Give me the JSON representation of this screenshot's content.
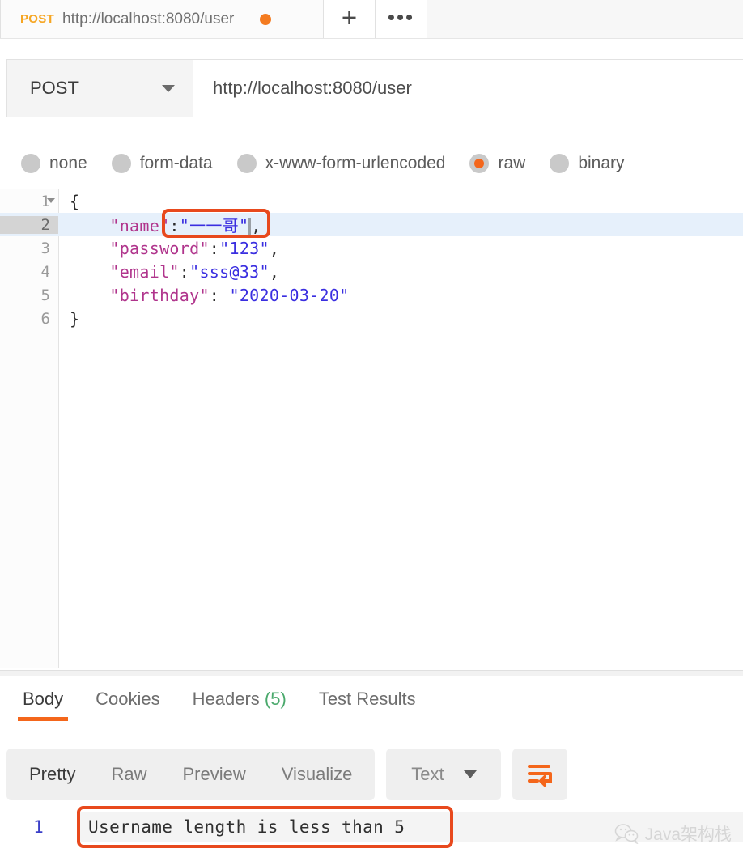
{
  "tab": {
    "method": "POST",
    "url": "http://localhost:8080/user",
    "unsaved_dot": "unsaved-indicator",
    "new_tab_label": "+",
    "more_label": "•••"
  },
  "request": {
    "method": "POST",
    "url": "http://localhost:8080/user",
    "body_types": [
      {
        "label": "none",
        "selected": false
      },
      {
        "label": "form-data",
        "selected": false
      },
      {
        "label": "x-www-form-urlencoded",
        "selected": false
      },
      {
        "label": "raw",
        "selected": true
      },
      {
        "label": "binary",
        "selected": false
      }
    ]
  },
  "editor": {
    "active_line": 2,
    "lines": [
      {
        "number": "1",
        "foldable": true,
        "text": "{"
      },
      {
        "number": "2",
        "foldable": false,
        "text": "    \"name\":\"一一哥\","
      },
      {
        "number": "3",
        "foldable": false,
        "text": "    \"password\":\"123\","
      },
      {
        "number": "4",
        "foldable": false,
        "text": "    \"email\":\"sss@33\","
      },
      {
        "number": "5",
        "foldable": false,
        "text": "    \"birthday\": \"2020-03-20\""
      },
      {
        "number": "6",
        "foldable": false,
        "text": "}"
      }
    ],
    "tokens": {
      "indent": "    ",
      "key_name": "\"name\"",
      "key_password": "\"password\"",
      "key_email": "\"email\"",
      "key_birthday": "\"birthday\"",
      "val_name": "\"一一哥\"",
      "val_password": "\"123\"",
      "val_email": "\"sss@33\"",
      "val_birthday": "\"2020-03-20\"",
      "colon": ":",
      "colon_space": ": ",
      "comma": ",",
      "brace_open": "{",
      "brace_close": "}"
    }
  },
  "response": {
    "tabs": [
      {
        "label": "Body",
        "active": true,
        "count": ""
      },
      {
        "label": "Cookies",
        "active": false,
        "count": ""
      },
      {
        "label": "Headers",
        "active": false,
        "count": "(5)"
      },
      {
        "label": "Test Results",
        "active": false,
        "count": ""
      }
    ],
    "formats": [
      {
        "label": "Pretty",
        "active": true
      },
      {
        "label": "Raw",
        "active": false
      },
      {
        "label": "Preview",
        "active": false
      },
      {
        "label": "Visualize",
        "active": false
      }
    ],
    "content_type": "Text",
    "wrap_icon": "wrap-lines-icon",
    "body_lines": [
      {
        "number": "1",
        "text": "Username length is less than 5"
      }
    ]
  },
  "annotations": {
    "name_value_box": "highlight-name-value",
    "response_box": "highlight-response-message",
    "color": "#e8491d"
  },
  "watermark": {
    "icon": "wechat-icon",
    "text": "Java架构栈"
  },
  "colors": {
    "accent": "#f4661b",
    "method_tab": "#f6a623",
    "json_key": "#b0348c",
    "json_value": "#3a2ee0",
    "active_line": "#e6f0fb",
    "headers_count": "#4aa96c"
  }
}
